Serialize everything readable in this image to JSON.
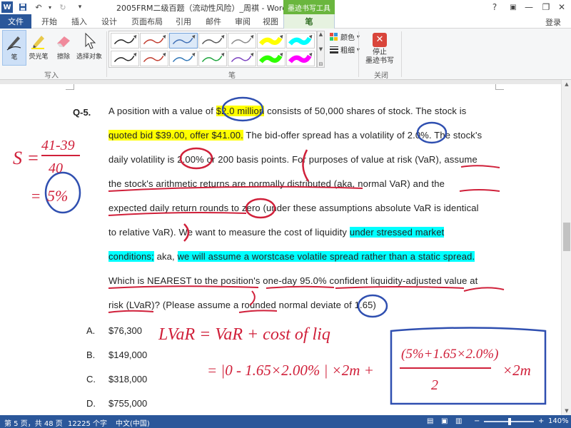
{
  "titlebar": {
    "title": "2005FRM二级百题（流动性风险）_周祺 - Word",
    "context_tab_group": "墨迹书写工具",
    "help": "?",
    "minimize": "—",
    "restore": "❐",
    "close": "✕"
  },
  "tabs": [
    "文件",
    "开始",
    "插入",
    "设计",
    "页面布局",
    "引用",
    "邮件",
    "审阅",
    "视图",
    "笔"
  ],
  "login": "登录",
  "ribbon": {
    "tools": [
      {
        "label": "笔",
        "icon": "pen-icon",
        "selected": true
      },
      {
        "label": "荧光笔",
        "icon": "highlighter-icon",
        "selected": false
      },
      {
        "label": "擦除",
        "icon": "eraser-icon",
        "selected": false
      },
      {
        "label": "选择对象",
        "icon": "select-arrow-icon",
        "selected": false
      }
    ],
    "group_write": "写入",
    "group_pens": "笔",
    "group_close": "关闭",
    "color_label": "颜色",
    "thickness_label": "粗细",
    "stop_label": "停止\n墨迹书写",
    "pen_colors_row1": [
      "#222222",
      "#c0392b",
      "#3f6fb5",
      "#555555",
      "#888888",
      "#ffff00",
      "#00ffff"
    ],
    "pen_colors_row2": [
      "#222222",
      "#c0392b",
      "#2e75b6",
      "#1aa33a",
      "#7a3fbf",
      "#2eff00",
      "#ff00ff"
    ]
  },
  "document": {
    "question_number": "Q-5.",
    "lines": [
      {
        "segments": [
          {
            "t": "A position with a value of "
          },
          {
            "t": "$2.0 million",
            "hl": "y"
          },
          {
            "t": " consists of 50,000 shares of stock. The stock is"
          }
        ]
      },
      {
        "segments": [
          {
            "t": "quoted bid $39.00, offer $41.00.",
            "hl": "y"
          },
          {
            "t": " The bid-offer spread has a volatility of 2.0%. The stock's"
          }
        ]
      },
      {
        "segments": [
          {
            "t": "daily volatility is 2.00% or 200 basis points. For purposes of value at risk (VaR), assume"
          }
        ]
      },
      {
        "segments": [
          {
            "t": "the stock's arithmetic returns are normally distributed (aka, normal VaR) and the"
          }
        ]
      },
      {
        "segments": [
          {
            "t": "expected daily return rounds to zero (under these assumptions absolute VaR is identical"
          }
        ]
      },
      {
        "segments": [
          {
            "t": "to relative VaR). We want to measure the cost of liquidity "
          },
          {
            "t": "under stressed market",
            "hl": "c"
          }
        ]
      },
      {
        "segments": [
          {
            "t": "conditions;",
            "hl": "c"
          },
          {
            "t": " aka, "
          },
          {
            "t": "we will assume a worstcase volatile spread rather than a static spread.",
            "hl": "c"
          }
        ]
      },
      {
        "segments": [
          {
            "t": "Which is NEAREST to the position's one-day 95.0% confident liquidity-adjusted value at"
          }
        ]
      },
      {
        "segments": [
          {
            "t": "risk (LVaR)? (Please assume a rounded normal deviate of 1.65)"
          }
        ]
      }
    ],
    "options": [
      {
        "letter": "A.",
        "value": "$76,300"
      },
      {
        "letter": "B.",
        "value": "$149,000"
      },
      {
        "letter": "C.",
        "value": "$318,000"
      },
      {
        "letter": "D.",
        "value": "$755,000"
      }
    ],
    "ink_notes": {
      "s_label": "S =",
      "numerator": "41-39",
      "denominator": "40",
      "equals_result": "=",
      "result": "5%",
      "lvar_eq": "LVaR = VaR + cost of liq",
      "formula_left": "= |0 - 1.65×2.00% | ×2m +",
      "formula_num": "(5%+1.65×2.0%)",
      "formula_den": "2",
      "formula_right": "×2m"
    }
  },
  "statusbar": {
    "page": "第 5 页，共 48 页",
    "words": "12225 个字",
    "lang": "中文(中国)",
    "zoom": "140%",
    "zoom_minus": "−",
    "zoom_plus": "+"
  }
}
